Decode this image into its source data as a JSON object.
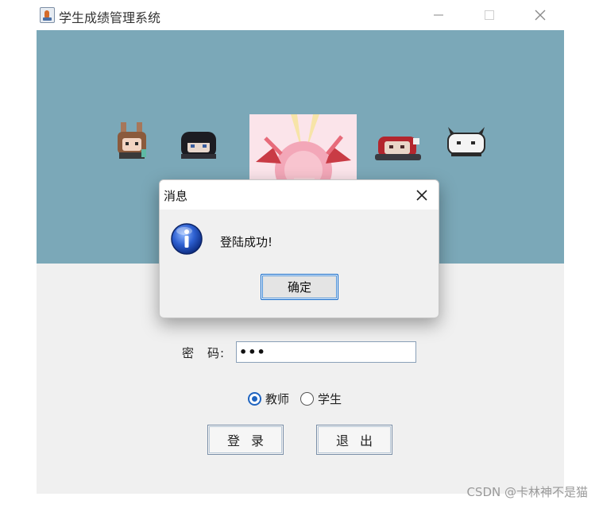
{
  "window": {
    "title": "学生成绩管理系统",
    "controls": [
      "minimize",
      "maximize",
      "close"
    ]
  },
  "banner": {
    "background_color": "#7ba8b8",
    "sprites": [
      "bunny-girl-sprite",
      "dark-hair-sprite",
      "pink-character-picture",
      "red-hood-sprite",
      "white-cat-sprite"
    ]
  },
  "form": {
    "password_label": "密　码:",
    "password_value": "•••",
    "role_options": [
      {
        "label": "教师",
        "checked": true
      },
      {
        "label": "学生",
        "checked": false
      }
    ],
    "login_label": "登录",
    "exit_label": "退出"
  },
  "dialog": {
    "title": "消息",
    "icon": "info-icon",
    "message": "登陆成功!",
    "ok_label": "确定"
  },
  "watermark": "CSDN @卡林神不是猫",
  "colors": {
    "accent": "#1f64c0",
    "banner": "#7ba8b8",
    "content_bg": "#f0f0f0"
  }
}
